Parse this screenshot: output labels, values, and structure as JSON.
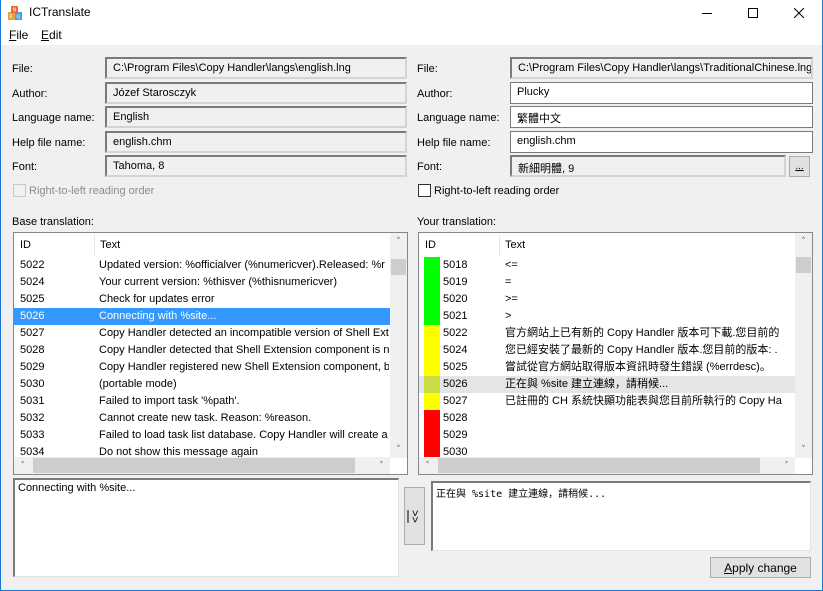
{
  "window": {
    "title": "ICTranslate",
    "controls": {
      "minimize": "minimize-icon",
      "maximize": "maximize-icon",
      "close": "close-icon"
    }
  },
  "menu": {
    "items": [
      {
        "label": "File",
        "accel": "F"
      },
      {
        "label": "Edit",
        "accel": "E"
      }
    ]
  },
  "base": {
    "file_label": "File:",
    "file": "C:\\Program Files\\Copy Handler\\langs\\english.lng",
    "author_label": "Author:",
    "author": "Józef Starosczyk",
    "language_label": "Language name:",
    "language": "English",
    "help_label": "Help file name:",
    "help": "english.chm",
    "font_label": "Font:",
    "font": "Tahoma, 8",
    "rtl_label": "Right-to-left reading order",
    "rtl_checked": false,
    "rtl_enabled": false,
    "section_label": "Base translation:",
    "columns": [
      "ID",
      "Text"
    ],
    "rows": [
      {
        "id": "5022",
        "text": "Updated version: %officialver (%numericver).Released: %r"
      },
      {
        "id": "5024",
        "text": "Your current version: %thisver (%thisnumericver)"
      },
      {
        "id": "5025",
        "text": "Check for updates error"
      },
      {
        "id": "5026",
        "text": "Connecting with %site...",
        "selected": true
      },
      {
        "id": "5027",
        "text": "Copy Handler detected an incompatible version of Shell Exte"
      },
      {
        "id": "5028",
        "text": "Copy Handler detected that Shell Extension component is no"
      },
      {
        "id": "5029",
        "text": "Copy Handler registered new Shell Extension component, bu"
      },
      {
        "id": "5030",
        "text": " (portable mode)"
      },
      {
        "id": "5031",
        "text": "Failed to import task '%path'."
      },
      {
        "id": "5032",
        "text": "Cannot create new task. Reason: %reason."
      },
      {
        "id": "5033",
        "text": "Failed to load task list database. Copy Handler will create a r"
      },
      {
        "id": "5034",
        "text": "Do not show this message again"
      }
    ],
    "edit_text": "Connecting with %site..."
  },
  "translation": {
    "file_label": "File:",
    "file": "C:\\Program Files\\Copy Handler\\langs\\TraditionalChinese.lng",
    "author_label": "Author:",
    "author": "Plucky",
    "language_label": "Language name:",
    "language": "繁體中文",
    "help_label": "Help file name:",
    "help": "english.chm",
    "font_label": "Font:",
    "font": "新細明體, 9",
    "font_button": "...",
    "rtl_label": "Right-to-left reading order",
    "rtl_checked": false,
    "section_label": "Your translation:",
    "columns": [
      "ID",
      "Text"
    ],
    "status_colors": {
      "ok": "#00ff00",
      "changed": "#ffff00",
      "current": "#c8dc46",
      "missing": "#ff0000"
    },
    "rows": [
      {
        "id": "5018",
        "text": "<=",
        "status": "ok"
      },
      {
        "id": "5019",
        "text": "=",
        "status": "ok"
      },
      {
        "id": "5020",
        "text": ">=",
        "status": "ok"
      },
      {
        "id": "5021",
        "text": ">",
        "status": "ok"
      },
      {
        "id": "5022",
        "text": "官方網站上已有新的 Copy Handler 版本可下載.您目前的",
        "status": "changed"
      },
      {
        "id": "5024",
        "text": "您已經安裝了最新的 Copy Handler 版本.您目前的版本: .",
        "status": "changed"
      },
      {
        "id": "5025",
        "text": "嘗試從官方網站取得版本資訊時發生錯誤 (%errdesc)。",
        "status": "changed"
      },
      {
        "id": "5026",
        "text": "正在與 %site 建立連線，請稍候...",
        "status": "current",
        "highlighted": true
      },
      {
        "id": "5027",
        "text": "已註冊的 CH 系統快顯功能表與您目前所執行的 Copy Ha",
        "status": "changed"
      },
      {
        "id": "5028",
        "text": "",
        "status": "missing"
      },
      {
        "id": "5029",
        "text": "",
        "status": "missing"
      },
      {
        "id": "5030",
        "text": "",
        "status": "missing"
      }
    ],
    "edit_text": "正在與 %site 建立連線，請稍候..."
  },
  "copy_button": {
    "label": ">>",
    "icon": "copy-arrow-icon"
  },
  "apply_button": {
    "label": "Apply change",
    "accel": "A"
  },
  "accent": "#3399ff"
}
